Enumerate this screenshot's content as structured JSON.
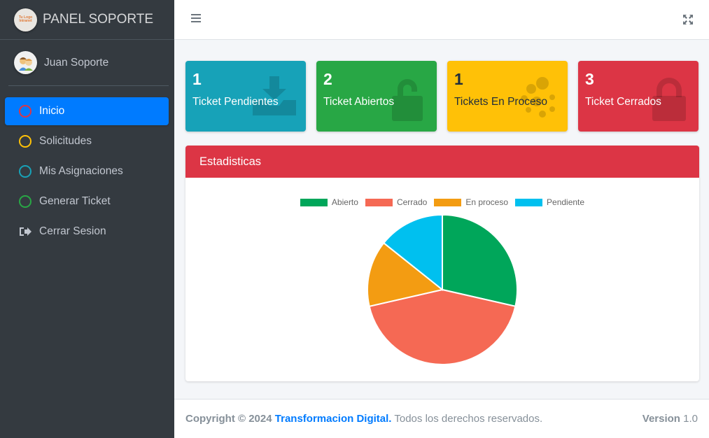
{
  "brand": {
    "title": "PANEL SOPORTE",
    "logo_text": "Tu Logo Intranet"
  },
  "user": {
    "name": "Juan Soporte"
  },
  "sidebar": {
    "items": [
      {
        "label": "Inicio",
        "icon": "circle-icon",
        "color": "#dc3545",
        "active": true
      },
      {
        "label": "Solicitudes",
        "icon": "circle-icon",
        "color": "#ffc107"
      },
      {
        "label": "Mis Asignaciones",
        "icon": "circle-icon",
        "color": "#17a2b8"
      },
      {
        "label": "Generar Ticket",
        "icon": "circle-icon",
        "color": "#28a745"
      },
      {
        "label": "Cerrar Sesion",
        "icon": "sign-out-icon"
      }
    ]
  },
  "stats": [
    {
      "count": "1",
      "label": "Ticket Pendientes",
      "icon": "download-icon",
      "color": "#17a2b8"
    },
    {
      "count": "2",
      "label": "Ticket Abiertos",
      "icon": "unlock-icon",
      "color": "#28a745"
    },
    {
      "count": "1",
      "label": "Tickets En Proceso",
      "icon": "bubbles-icon",
      "color": "#ffc107"
    },
    {
      "count": "3",
      "label": "Ticket Cerrados",
      "icon": "lock-icon",
      "color": "#dc3545"
    }
  ],
  "card": {
    "title": "Estadisticas"
  },
  "chart_data": {
    "type": "pie",
    "labels": [
      "Abierto",
      "Cerrado",
      "En proceso",
      "Pendiente"
    ],
    "values": [
      2,
      3,
      1,
      1
    ],
    "colors": [
      "#00a65a",
      "#f56954",
      "#f39c12",
      "#00c0ef"
    ],
    "legend": "top"
  },
  "footer": {
    "copyright": "Copyright © 2024",
    "company": "Transformacion Digital.",
    "rights": "Todos los derechos reservados.",
    "version_label": "Version",
    "version": "1.0"
  }
}
